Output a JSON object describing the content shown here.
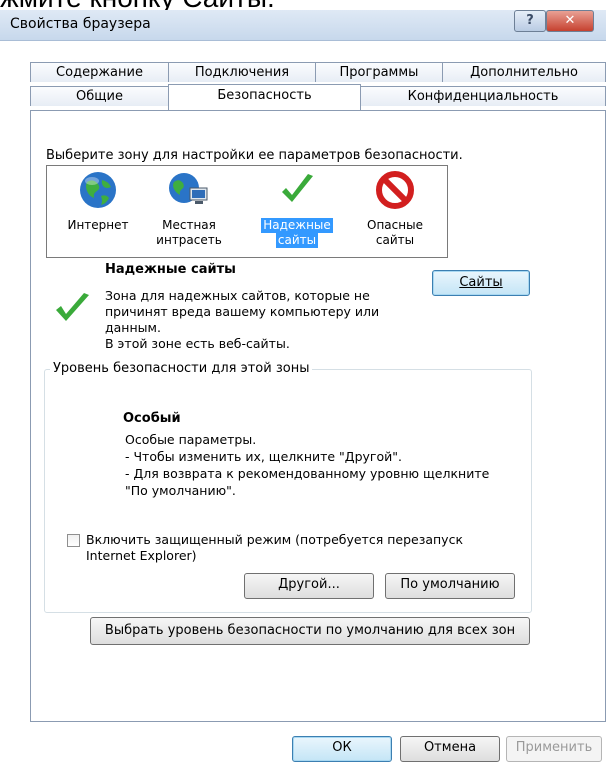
{
  "top_caption": "жмите кнопку Сайты.",
  "window": {
    "title": "Свойства браузера",
    "help_glyph": "?",
    "close_glyph": "✕"
  },
  "tabs_row1": [
    "Содержание",
    "Подключения",
    "Программы",
    "Дополнительно"
  ],
  "tabs_row2": [
    "Общие",
    "Безопасность",
    "Конфиденциальность"
  ],
  "active_tab": "Безопасность",
  "zones_prompt": "Выберите зону для настройки ее параметров безопасности.",
  "zones": [
    {
      "line1": "Интернет",
      "line2": "",
      "icon": "globe-icon"
    },
    {
      "line1": "Местная",
      "line2": "интрасеть",
      "icon": "intranet-icon"
    },
    {
      "line1": "Надежные",
      "line2": "сайты",
      "icon": "checkmark-icon",
      "selected": true
    },
    {
      "line1": "Опасные",
      "line2": "сайты",
      "icon": "no-sign-icon"
    }
  ],
  "zone_info": {
    "title": "Надежные сайты",
    "desc1": "Зона для надежных сайтов, которые не",
    "desc2": "причинят вреда вашему компьютеру или",
    "desc3": "данным.",
    "desc4": "В этой зоне есть веб-сайты."
  },
  "sites_button": "Сайты",
  "security_level": {
    "group_label": "Уровень безопасности для этой зоны",
    "level_name": "Особый",
    "line1": "Особые параметры.",
    "line2": "- Чтобы изменить их, щелкните \"Другой\".",
    "line3": "- Для возврата к рекомендованному уровню щелкните",
    "line4": "\"По умолчанию\"."
  },
  "protected_mode": {
    "label1": "Включить защищенный режим (потребуется перезапуск",
    "label2": "Internet Explorer)",
    "checked": false
  },
  "buttons": {
    "custom": "Другой...",
    "default": "По умолчанию",
    "reset_all": "Выбрать уровень безопасности по умолчанию для всех зон",
    "ok": "ОК",
    "cancel": "Отмена",
    "apply": "Применить"
  },
  "colors": {
    "selection": "#3399ff",
    "check_green": "#3aaa3a",
    "danger_red": "#d21f1f",
    "titlebar": "#dfe9f5"
  }
}
